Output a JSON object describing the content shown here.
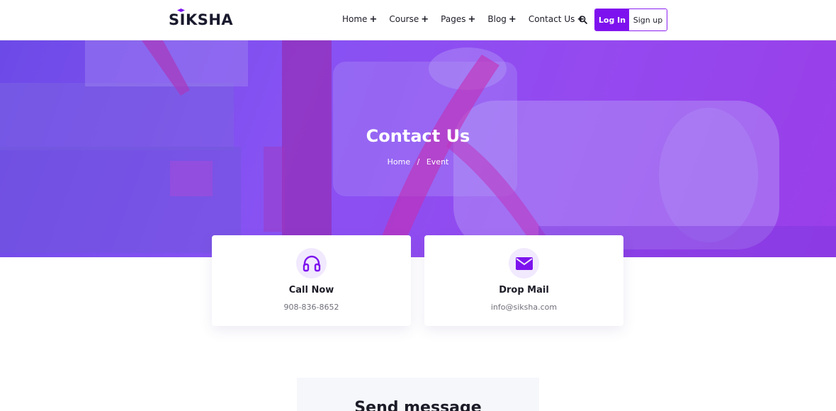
{
  "header": {
    "logo": "SIKSHA",
    "nav": [
      {
        "label": "Home",
        "suffix": "+"
      },
      {
        "label": "Course",
        "suffix": "+"
      },
      {
        "label": "Pages",
        "suffix": "+"
      },
      {
        "label": "Blog",
        "suffix": "+"
      },
      {
        "label": "Contact Us",
        "suffix": "+"
      }
    ],
    "login_label": "Log In",
    "signup_label": "Sign up"
  },
  "hero": {
    "title": "Contact Us",
    "breadcrumb": {
      "home": "Home",
      "separator": "/",
      "current": "Event"
    }
  },
  "cards": {
    "call": {
      "title": "Call Now",
      "value": "908-836-8652",
      "icon": "headphones-icon"
    },
    "mail": {
      "title": "Drop Mail",
      "value": "info@siksha.com",
      "icon": "envelope-icon"
    }
  },
  "message_section": {
    "title": "Send message"
  },
  "colors": {
    "accent": "#7d12ee",
    "icon_bg": "#f1e9fe"
  }
}
